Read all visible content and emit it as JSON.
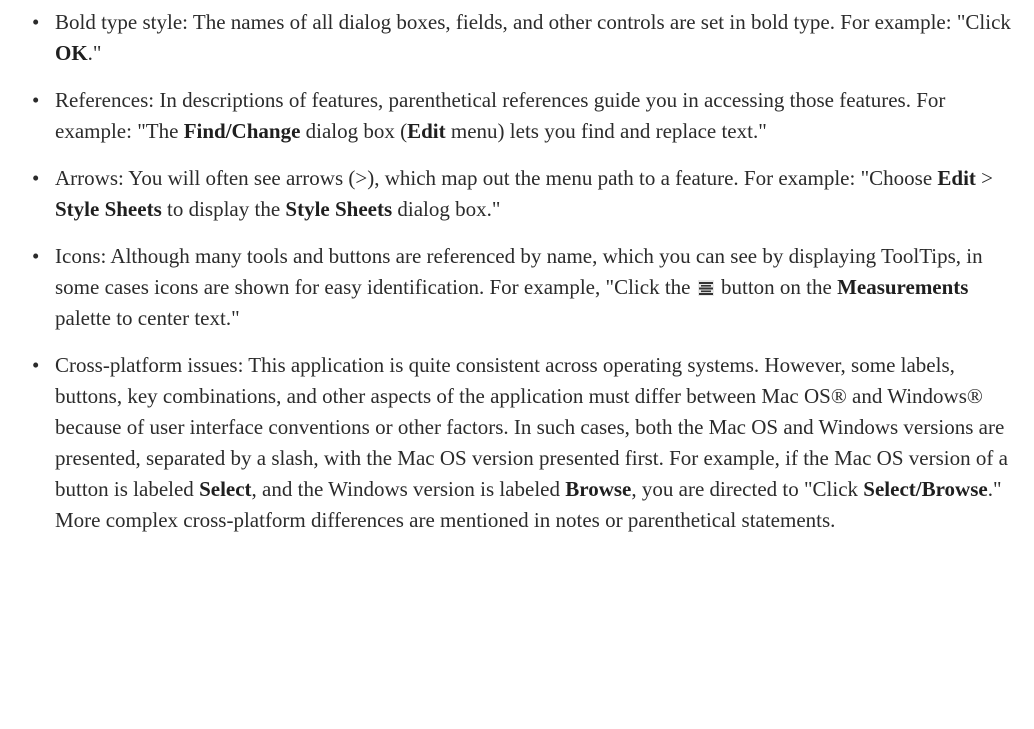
{
  "items": [
    {
      "parts": [
        {
          "t": "Bold type style: The names of all dialog boxes, fields, and other controls are set in bold type. For example: \"Click "
        },
        {
          "t": "OK",
          "b": true
        },
        {
          "t": ".\""
        }
      ]
    },
    {
      "parts": [
        {
          "t": "References: In descriptions of features, parenthetical references guide you in accessing those features. For example: \"The "
        },
        {
          "t": "Find/Change",
          "b": true
        },
        {
          "t": " dialog box ("
        },
        {
          "t": "Edit",
          "b": true
        },
        {
          "t": " menu) lets you find and replace text.\""
        }
      ]
    },
    {
      "parts": [
        {
          "t": "Arrows: You will often see arrows (>), which map out the menu path to a feature. For example: \"Choose "
        },
        {
          "t": "Edit",
          "b": true
        },
        {
          "t": " > "
        },
        {
          "t": "Style Sheets",
          "b": true
        },
        {
          "t": " to display the "
        },
        {
          "t": "Style Sheets",
          "b": true
        },
        {
          "t": " dialog box.\""
        }
      ]
    },
    {
      "parts": [
        {
          "t": "Icons: Although many tools and buttons are referenced by name, which you can see by displaying ToolTips, in some cases icons are shown for easy identification. For example, \"Click the "
        },
        {
          "icon": "center-align-icon"
        },
        {
          "t": " button on the "
        },
        {
          "t": "Measurements",
          "b": true
        },
        {
          "t": " palette to center text.\""
        }
      ]
    },
    {
      "parts": [
        {
          "t": "Cross-platform issues: This application is quite consistent across operating systems. However, some labels, buttons, key combinations, and other aspects of the application must differ between Mac OS® and Windows® because of user interface conventions or other factors. In such cases, both the Mac OS and Windows versions are presented, separated by a slash, with the Mac OS version presented first. For example, if the Mac OS version of a button is labeled "
        },
        {
          "t": "Select",
          "b": true
        },
        {
          "t": ", and the Windows version is labeled "
        },
        {
          "t": "Browse",
          "b": true
        },
        {
          "t": ", you are directed to \"Click "
        },
        {
          "t": "Select/Browse",
          "b": true
        },
        {
          "t": ".\" More complex cross-platform differences are mentioned in notes or parenthetical statements."
        }
      ]
    }
  ]
}
